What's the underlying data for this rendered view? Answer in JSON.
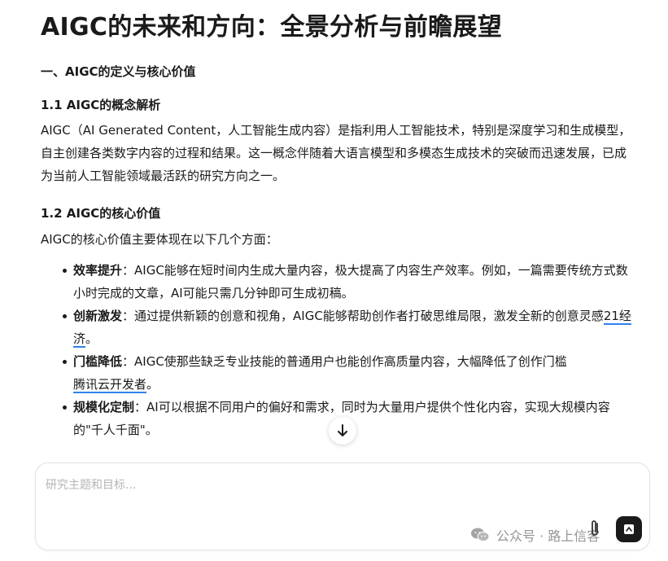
{
  "document": {
    "title": "AIGC的未来和方向：全景分析与前瞻展望",
    "section1_heading": "一、AIGC的定义与核心价值",
    "sub1_heading": "1.1 AIGC的概念解析",
    "sub1_paragraph": "AIGC（AI Generated Content，人工智能生成内容）是指利用人工智能技术，特别是深度学习和生成模型，自主创建各类数字内容的过程和结果。这一概念伴随着大语言模型和多模态生成技术的突破而迅速发展，已成为当前人工智能领域最活跃的研究方向之一。",
    "sub2_heading": "1.2 AIGC的核心价值",
    "sub2_intro": "AIGC的核心价值主要体现在以下几个方面：",
    "bullets": [
      {
        "term": "效率提升",
        "text": "：AIGC能够在短时间内生成大量内容，极大提高了内容生产效率。例如，一篇需要传统方式数小时完成的文章，AI可能只需几分钟即可生成初稿。",
        "link": "",
        "tail": ""
      },
      {
        "term": "创新激发",
        "text": "：通过提供新颖的创意和视角，AIGC能够帮助创作者打破思维局限，激发全新的创意灵感",
        "link": "21经济",
        "tail": "。"
      },
      {
        "term": "门槛降低",
        "text": "：AIGC使那些缺乏专业技能的普通用户也能创作高质量内容，大幅降低了创作门槛",
        "link": "腾讯云开发者",
        "tail": "。"
      },
      {
        "term": "规模化定制",
        "text": "：AI可以根据不同用户的偏好和需求，同时为大量用户提供个性化内容，实现大规模内容的\"千人千面\"。",
        "link": "",
        "tail": ""
      }
    ]
  },
  "composer": {
    "placeholder": "研究主题和目标...",
    "value": ""
  },
  "watermark": {
    "text": "公众号 · 路上信客"
  },
  "icons": {
    "scroll_down": "arrow-down-icon",
    "attach": "paperclip-icon",
    "send": "send-icon",
    "watermark": "wechat-icon"
  },
  "colors": {
    "link_underline": "#2f80ed",
    "send_button": "#1a1a1a",
    "placeholder": "#b5b5b5"
  }
}
